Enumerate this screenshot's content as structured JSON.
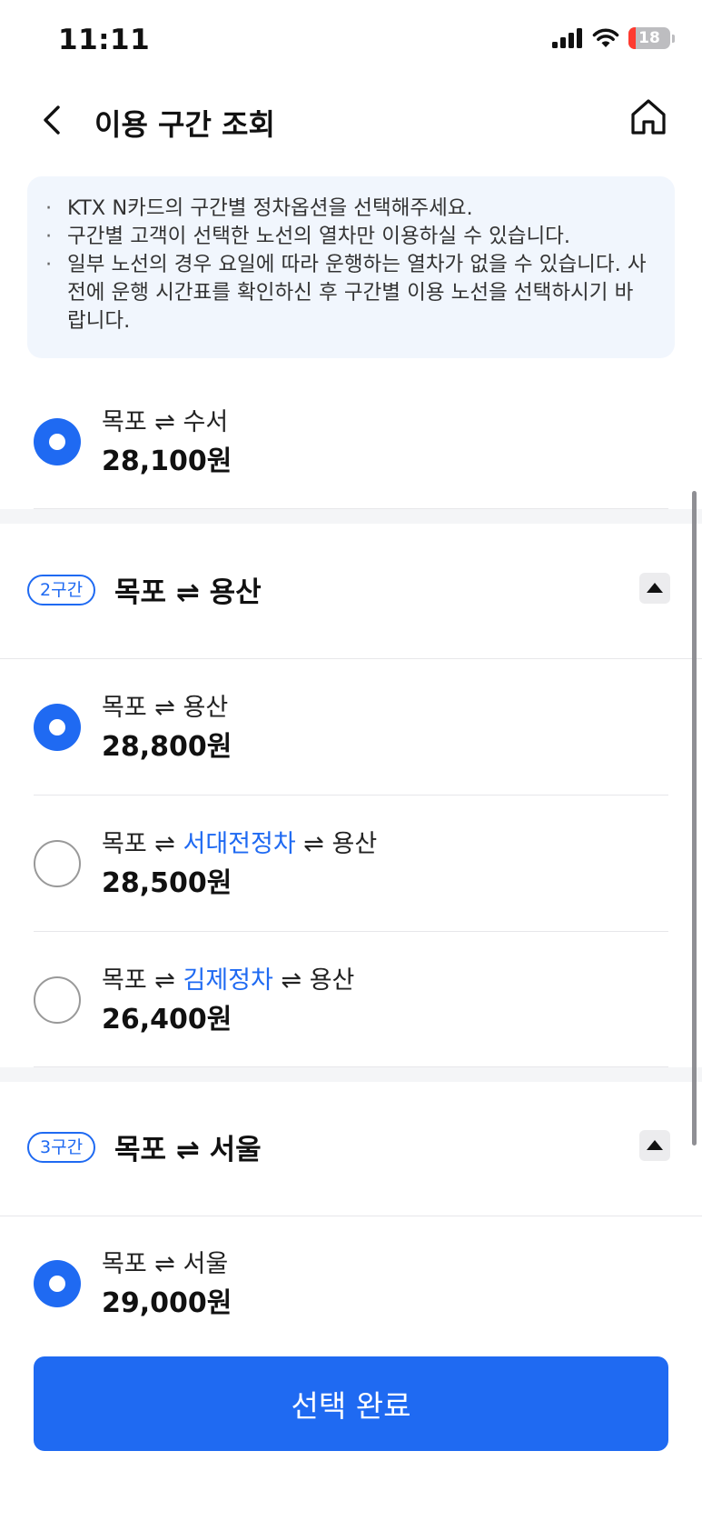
{
  "status_bar": {
    "time": "11:11",
    "battery": "18"
  },
  "header": {
    "title": "이용 구간 조회"
  },
  "notice": {
    "items": [
      "KTX N카드의 구간별 정차옵션을 선택해주세요.",
      "구간별 고객이 선택한 노선의 열차만 이용하실 수 있습니다.",
      "일부 노선의 경우 요일에 따라 운행하는 열차가 없을 수 있습니다. 사전에 운행 시간표를 확인하신 후 구간별 이용 노선을 선택하시기 바랍니다."
    ]
  },
  "arrow": "⇌",
  "section1": {
    "options": [
      {
        "from": "목포",
        "to": "수서",
        "price": "28,100원",
        "selected": true
      }
    ]
  },
  "section2": {
    "badge": "2구간",
    "title_from": "목포",
    "title_to": "용산",
    "options": [
      {
        "from": "목포",
        "to": "용산",
        "price": "28,800원",
        "selected": true
      },
      {
        "from": "목포",
        "via": "서대전정차",
        "to": "용산",
        "price": "28,500원",
        "selected": false
      },
      {
        "from": "목포",
        "via": "김제정차",
        "to": "용산",
        "price": "26,400원",
        "selected": false
      }
    ]
  },
  "section3": {
    "badge": "3구간",
    "title_from": "목포",
    "title_to": "서울",
    "options": [
      {
        "from": "목포",
        "to": "서울",
        "price": "29,000원",
        "selected": true
      }
    ]
  },
  "footer": {
    "confirm_label": "선택 완료"
  },
  "colors": {
    "accent": "#1f6af2",
    "notice_bg": "#f1f6fd",
    "battery_low": "#ff3b30"
  }
}
